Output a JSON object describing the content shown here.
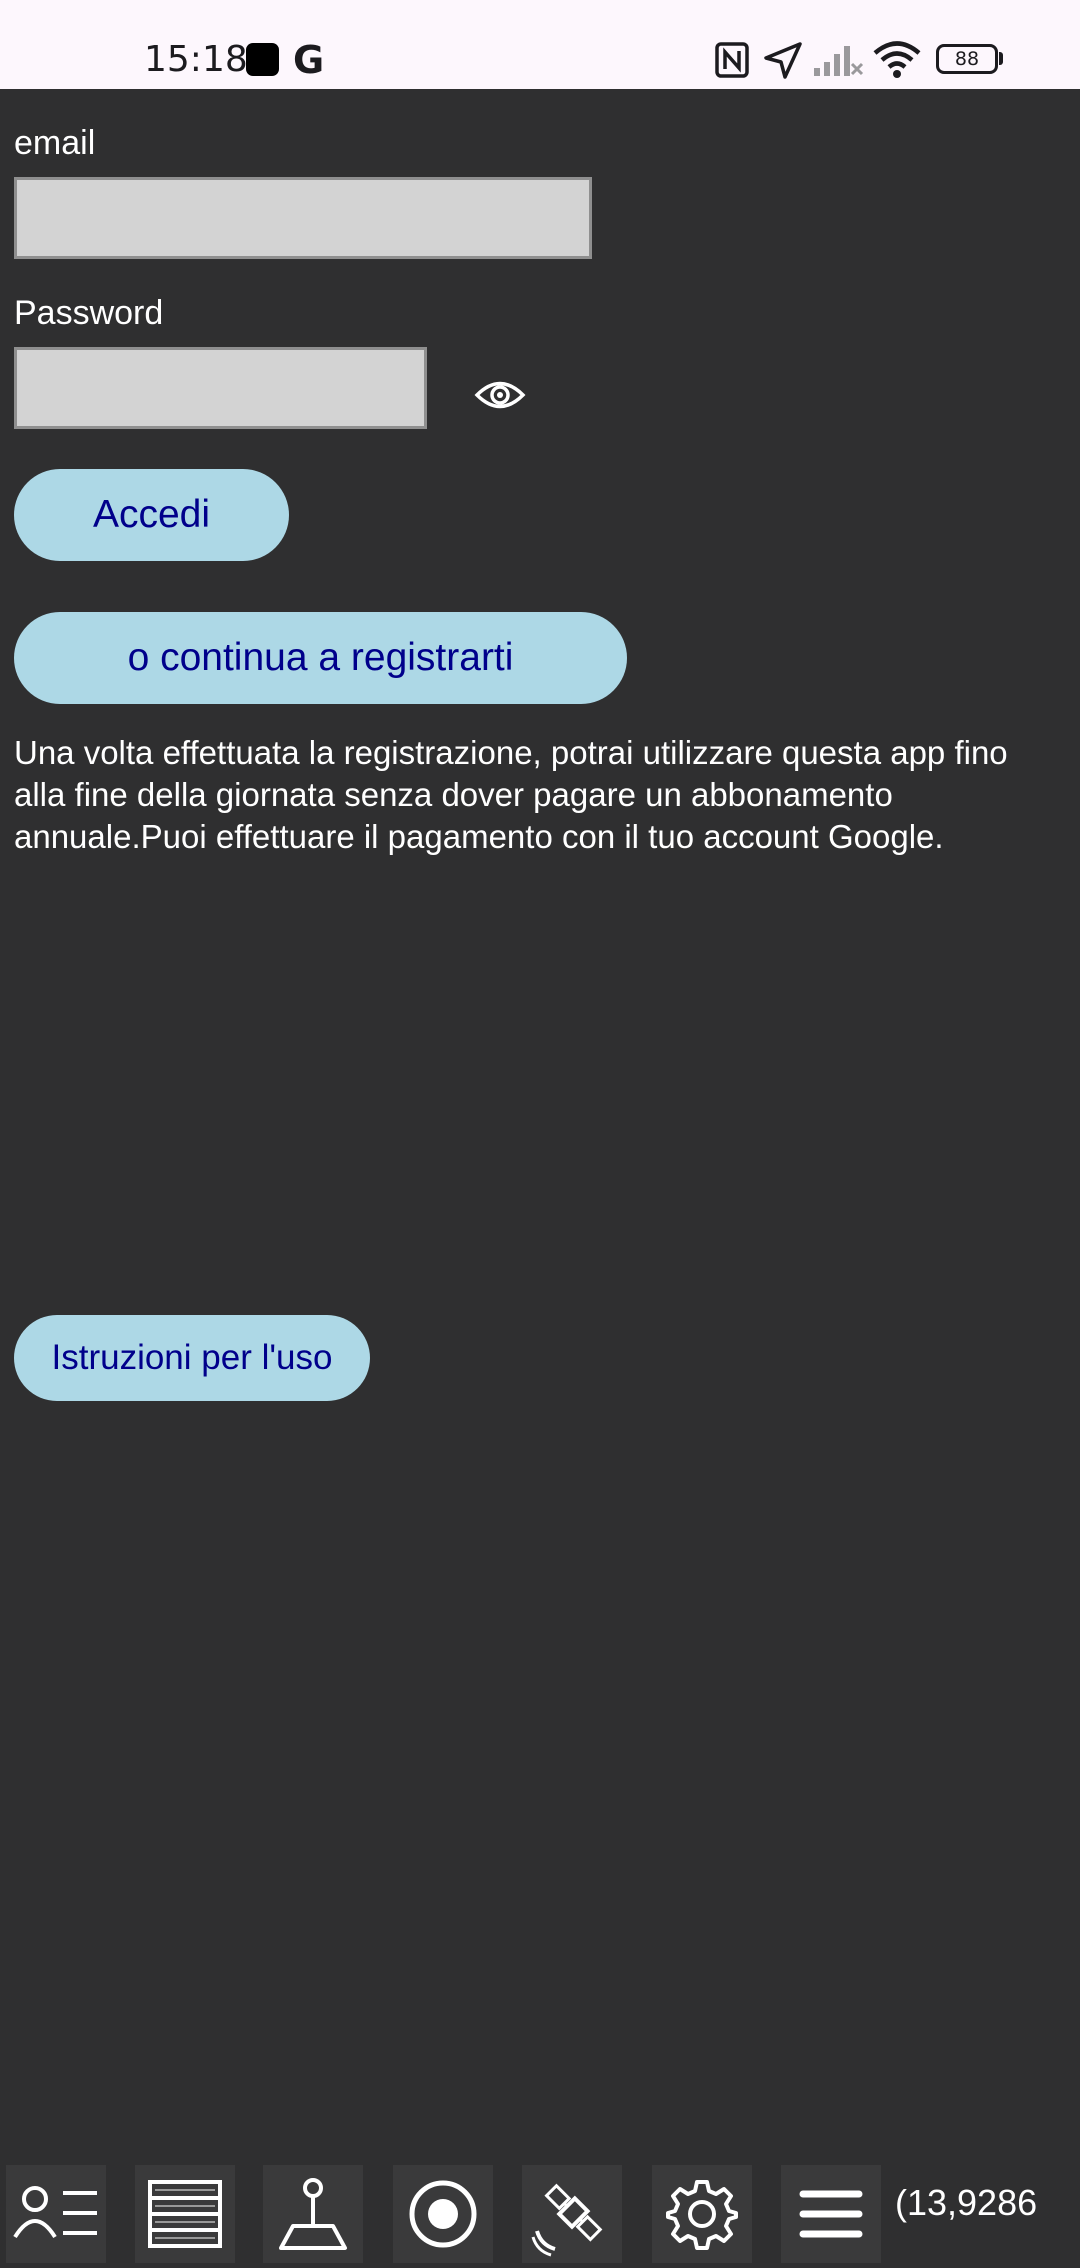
{
  "status_bar": {
    "time": "15:18",
    "app_g": "G",
    "battery": "88",
    "icons": [
      "nfc-icon",
      "location-arrow-icon",
      "signal-icon",
      "wifi-icon",
      "battery-icon"
    ]
  },
  "form": {
    "email_label": "email",
    "email_value": "",
    "password_label": "Password",
    "password_value": ""
  },
  "buttons": {
    "login": "Accedi",
    "register": "o continua a registrarti",
    "instructions": "Istruzioni per l'uso"
  },
  "info_text": "Una volta effettuata la registrazione, potrai utilizzare questa app fino alla fine della giornata senza dover pagare un abbonamento annuale.Puoi effettuare il pagamento con il tuo account Google.",
  "bottom_nav": {
    "icons": [
      "user-list-icon",
      "layers-list-icon",
      "pin-map-icon",
      "record-icon",
      "satellite-icon",
      "gear-icon",
      "menu-icon"
    ],
    "coordinate_readout": "(13,9286"
  },
  "colors": {
    "background": "#2f2f30",
    "button_bg": "#add8e6",
    "button_text": "#00008b",
    "input_bg": "#d3d3d3"
  }
}
